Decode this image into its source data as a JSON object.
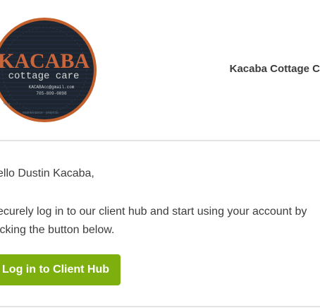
{
  "header": {
    "logo": {
      "brand_top": "KACABA",
      "brand_sub": "cottage care",
      "email": "KACABAcc@gmail.com",
      "phone": "705-809-0898",
      "ring_left": "cottage",
      "ring_right": "maintenance · projects",
      "colors": {
        "ring": "#c3602c",
        "background": "#1c2530",
        "brand": "#c9663c",
        "subtext": "#d7d7d7"
      }
    },
    "company_name": "Kacaba Cottage C"
  },
  "email_body": {
    "greeting": "ello Dustin Kacaba,",
    "line1": "ecurely log in to our client hub and start using your account by",
    "line2": "icking the button below."
  },
  "cta": {
    "label": "Log in to Client Hub",
    "color": "#7db00e"
  }
}
